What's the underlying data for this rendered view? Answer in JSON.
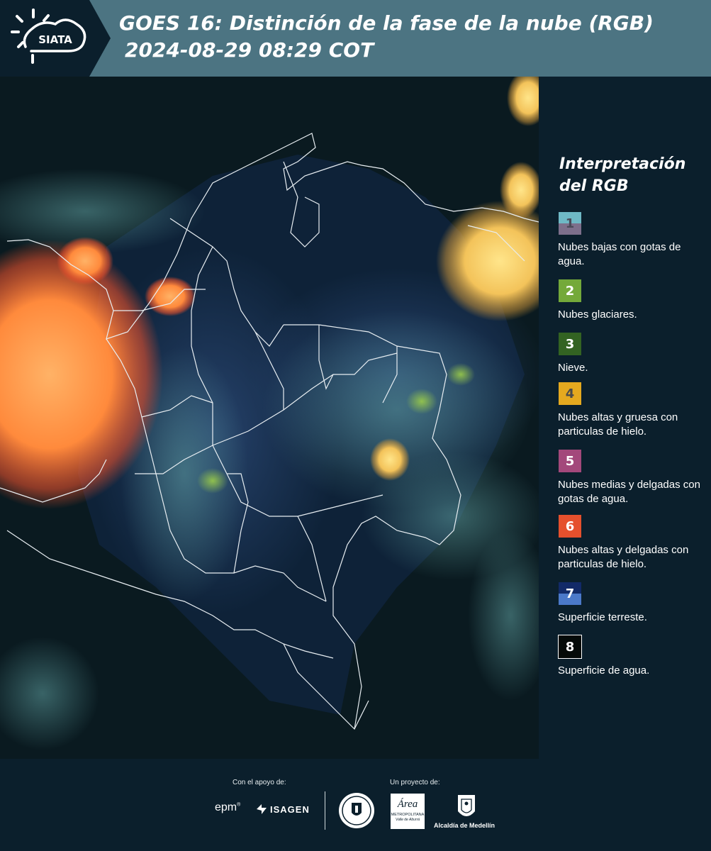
{
  "header": {
    "title_line1": "GOES 16: Distinción de la fase de la nube (RGB)",
    "title_line2": "2024-08-29 08:29 COT",
    "logo_text": "SIATA"
  },
  "legend": {
    "title": "Interpretación del RGB",
    "items": [
      {
        "number": "1",
        "label": "Nubes bajas con gotas de agua.",
        "color_top": "#6fb8c5",
        "color_bottom": "#7d6f8b",
        "number_color": "#4a4a58"
      },
      {
        "number": "2",
        "label": "Nubes glaciares.",
        "color_top": "#74a93a",
        "color_bottom": "#74a93a",
        "number_color": "#ffffff"
      },
      {
        "number": "3",
        "label": "Nieve.",
        "color_top": "#336322",
        "color_bottom": "#336322",
        "number_color": "#ffffff"
      },
      {
        "number": "4",
        "label": "Nubes altas y gruesa con particulas de hielo.",
        "color_top": "#e5a91f",
        "color_bottom": "#e5a91f",
        "number_color": "#4a4a4a"
      },
      {
        "number": "5",
        "label": "Nubes medias y delgadas con gotas de agua.",
        "color_top": "#a3487b",
        "color_bottom": "#a3487b",
        "number_color": "#ffffff"
      },
      {
        "number": "6",
        "label": "Nubes altas y delgadas con particulas de hielo.",
        "color_top": "#e5502d",
        "color_bottom": "#e5502d",
        "number_color": "#ffffff"
      },
      {
        "number": "7",
        "label": "Superficie terreste.",
        "color_top": "#122a68",
        "color_bottom": "#4b79c9",
        "number_color": "#ffffff"
      },
      {
        "number": "8",
        "label": "Superficie de agua.",
        "color_top": "#050a08",
        "color_bottom": "#050a08",
        "number_color": "#ffffff"
      }
    ]
  },
  "footer": {
    "support_caption": "Con el apoyo de:",
    "project_caption": "Un proyecto de:",
    "sponsor_epm": "epm",
    "sponsor_isagen": "ISAGEN",
    "partner_area_name": "Área",
    "partner_area_sub1": "METROPOLITANA",
    "partner_area_sub2": "Valle de Aburrá",
    "partner_alcaldia": "Alcaldía de Medellín"
  },
  "colors": {
    "header_bg": "#4c7482",
    "panel_bg": "#0b1f2c",
    "border_line": "#e8eef2"
  }
}
